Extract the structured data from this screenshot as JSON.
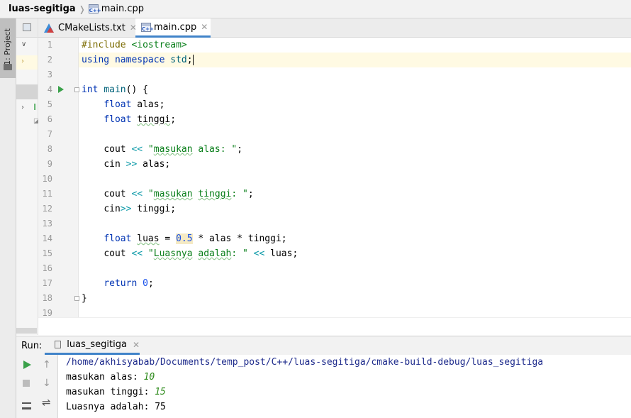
{
  "breadcrumb": {
    "project": "luas-segitiga",
    "file": "main.cpp"
  },
  "toolstrip": {
    "project_label": "1: Project"
  },
  "tabs": [
    {
      "label": "CMakeLists.txt",
      "icon": "cmake-icon"
    },
    {
      "label": "main.cpp",
      "icon": "cpp-file-icon",
      "active": true
    }
  ],
  "editor": {
    "line_numbers": [
      "1",
      "2",
      "3",
      "4",
      "5",
      "6",
      "7",
      "8",
      "9",
      "10",
      "11",
      "12",
      "13",
      "14",
      "15",
      "16",
      "17",
      "18",
      "19"
    ],
    "cursor_line": 2,
    "code": {
      "l1_pp": "#include",
      "l1_inc": "<iostream>",
      "l2_kw1": "using",
      "l2_kw2": "namespace",
      "l2_ns": "std",
      "l2_semi": ";",
      "l4_kw": "int",
      "l4_fn": "main",
      "l4_rest": "() {",
      "l5_kw": "float",
      "l5_rest": " alas;",
      "l6_kw": "float",
      "l6_rest_a": " ",
      "l6_rest_b": "tinggi",
      "l6_rest_c": ";",
      "l8_a": "cout ",
      "l8_op": "<<",
      "l8_q1": " \"",
      "l8_sq": "masukan",
      "l8_q2": " alas: \"",
      "l8_end": ";",
      "l9_a": "cin ",
      "l9_op": ">>",
      "l9_b": " alas;",
      "l11_a": "cout ",
      "l11_op": "<<",
      "l11_q1": " \"",
      "l11_sq1": "masukan",
      "l11_sp": " ",
      "l11_sq2": "tinggi",
      "l11_q2": ": \"",
      "l11_end": ";",
      "l12_a": "cin",
      "l12_op": ">>",
      "l12_b": " tinggi;",
      "l14_kw": "float",
      "l14_a": " ",
      "l14_sq": "luas",
      "l14_b": " = ",
      "l14_num": "0.5",
      "l14_c": " * alas * tinggi;",
      "l15_a": "cout ",
      "l15_op1": "<<",
      "l15_q1": " \"",
      "l15_sq1": "Luasnya",
      "l15_sp": " ",
      "l15_sq2": "adalah",
      "l15_q2": ": \"",
      "l15_sp2": " ",
      "l15_op2": "<<",
      "l15_b": " luas;",
      "l17_kw": "return",
      "l17_sp": " ",
      "l17_num": "0",
      "l17_end": ";",
      "l18": "}"
    }
  },
  "run_panel": {
    "label": "Run:",
    "tab": "luas_segitiga",
    "console": {
      "path": "/home/akhisyabab/Documents/temp_post/C++/luas-segitiga/cmake-build-debug/luas_segitiga",
      "line2_prompt": "masukan alas: ",
      "line2_input": "10",
      "line3_prompt": "masukan tinggi: ",
      "line3_input": "15",
      "line4": "Luasnya adalah: 75"
    }
  },
  "colors": {
    "keyword": "#0033b3",
    "string": "#067d17",
    "number": "#1750eb",
    "run_green": "#3aa14a",
    "tab_underline": "#4083c9",
    "current_line": "#fffae3"
  }
}
